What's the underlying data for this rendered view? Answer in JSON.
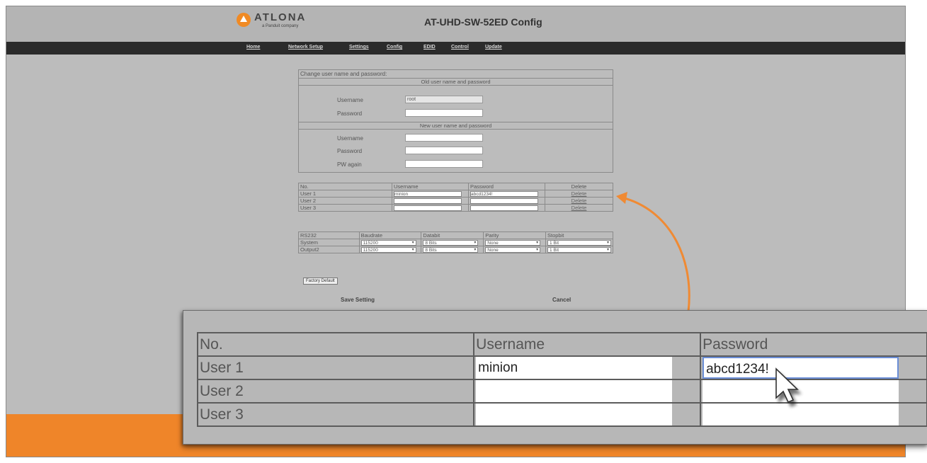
{
  "header": {
    "logo_word": "ATLONA",
    "logo_sub": "a Panduit company",
    "title": "AT-UHD-SW-52ED Config"
  },
  "nav": {
    "items": [
      "Home",
      "Network Setup",
      "Settings",
      "Config",
      "EDID",
      "Control",
      "Update"
    ]
  },
  "credentials": {
    "heading": "Change user name and password:",
    "old_section": "Old user name and password",
    "new_section": "New user name and password",
    "username_label": "Username",
    "password_label": "Password",
    "pw_again_label": "PW again",
    "old_username_value": "root"
  },
  "users_table": {
    "headers": [
      "No.",
      "Username",
      "Password",
      "Delete"
    ],
    "rows": [
      {
        "label": "User 1",
        "username": "minion",
        "password": "abcd1234!",
        "delete": "Delete"
      },
      {
        "label": "User 2",
        "username": "",
        "password": "",
        "delete": "Delete"
      },
      {
        "label": "User 3",
        "username": "",
        "password": "",
        "delete": "Delete"
      }
    ]
  },
  "rs232_table": {
    "headers": [
      "RS232",
      "Baudrate",
      "Databit",
      "Parity",
      "Stopbit"
    ],
    "rows": [
      {
        "label": "System",
        "baudrate": "115200",
        "databit": "8 Bits",
        "parity": "None",
        "stopbit": "1 Bit"
      },
      {
        "label": "Output2",
        "baudrate": "115200",
        "databit": "8 Bits",
        "parity": "None",
        "stopbit": "1 Bit"
      }
    ]
  },
  "buttons": {
    "factory_default": "Factory Default",
    "save": "Save Setting",
    "cancel": "Cancel"
  },
  "zoom_table": {
    "headers": [
      "No.",
      "Username",
      "Password"
    ],
    "rows": [
      {
        "label": "User 1",
        "username": "minion",
        "password": "abcd1234!"
      },
      {
        "label": "User 2",
        "username": "",
        "password": ""
      },
      {
        "label": "User 3",
        "username": "",
        "password": ""
      }
    ]
  },
  "colors": {
    "accent": "#ef8529",
    "navbar": "#2b2b2b",
    "background": "#b8b8b8"
  },
  "icons": {
    "logo": "atlona-logo-icon",
    "pointer": "mouse-cursor-icon",
    "callout": "curved-arrow-icon"
  }
}
